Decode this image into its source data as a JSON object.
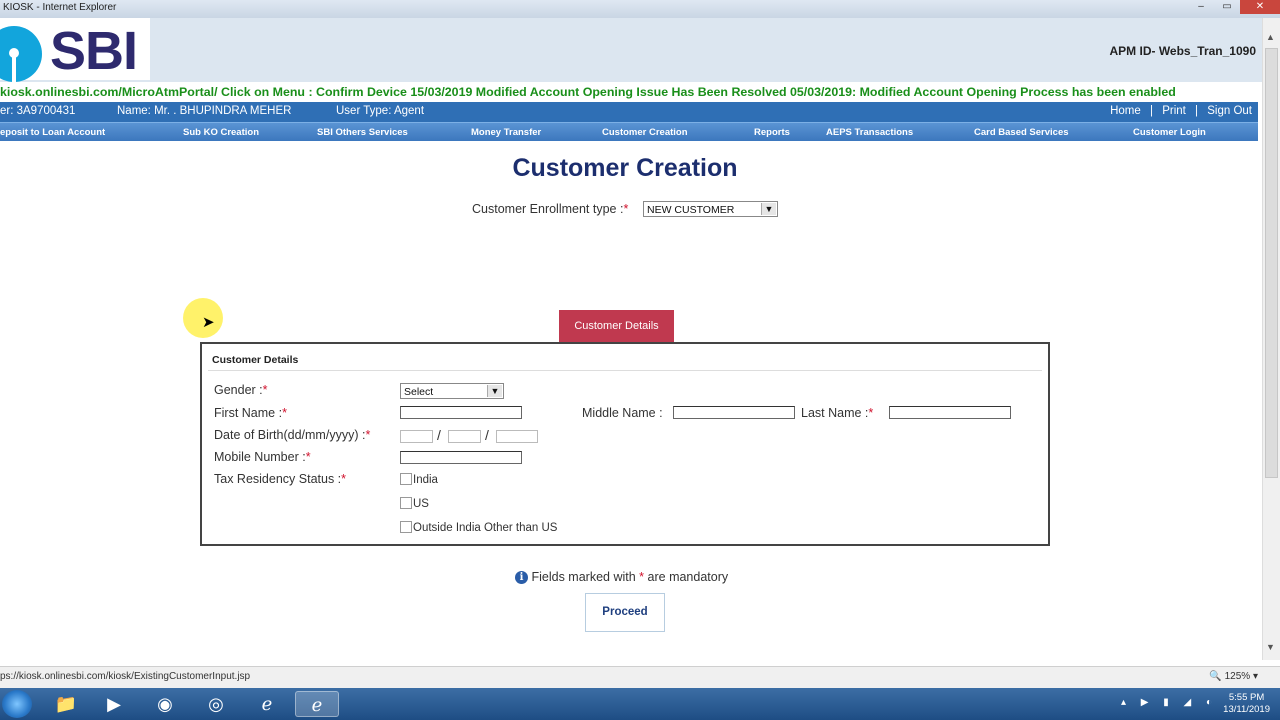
{
  "window": {
    "title": "KIOSK - Internet Explorer"
  },
  "header": {
    "logo_text": "SBI",
    "apm_id": "APM ID- Webs_Tran_1090"
  },
  "marquee": "kiosk.onlinesbi.com/MicroAtmPortal/ Click on Menu : Confirm Device 15/03/2019 Modified Account Opening Issue Has Been Resolved 05/03/2019: Modified Account Opening Process has been enabled",
  "userbar": {
    "user_id": "er: 3A9700431",
    "name": "Name:  Mr. . BHUPINDRA MEHER",
    "user_type": "User Type:  Agent",
    "home": "Home",
    "print": "Print",
    "sign_out": "Sign Out",
    "sep": "|"
  },
  "nav": [
    "eposit to Loan Account",
    "Sub KO Creation",
    "SBI Others Services",
    "Money Transfer",
    "Customer Creation",
    "Reports",
    "AEPS Transactions",
    "Card Based Services",
    "Customer Login"
  ],
  "page": {
    "title": "Customer Creation",
    "enroll_label": "Customer Enrollment type  :",
    "enroll_value": "NEW CUSTOMER",
    "tab_label": "Customer Details"
  },
  "form": {
    "heading": "Customer Details",
    "gender_label": "Gender  :",
    "gender_value": "Select",
    "first_name_label": "First Name  :",
    "middle_name_label": "Middle Name  :",
    "last_name_label": "Last Name  :",
    "dob_label": "Date of Birth(dd/mm/yyyy)  :",
    "mobile_label": "Mobile Number :",
    "tax_label": "Tax Residency Status  :",
    "tax_options": [
      "India",
      "US",
      "Outside India Other than US"
    ],
    "required_mark": "*",
    "date_sep": "/"
  },
  "footer": {
    "mandatory_note": "Fields marked with",
    "mandatory_note_end": "are mandatory",
    "info_glyph": "i",
    "proceed": "Proceed"
  },
  "statusbar": {
    "url": "ps://kiosk.onlinesbi.com/kiosk/ExistingCustomerInput.jsp",
    "zoom": "125%"
  },
  "taskbar": {
    "time": "5:55 PM",
    "date": "13/11/2019"
  },
  "colors": {
    "nav_blue": "#3c77bd",
    "title_navy": "#1c2e6e",
    "tab_red": "#c0394f",
    "marquee_green": "#1a8f1a",
    "required_red": "#d0102b"
  }
}
